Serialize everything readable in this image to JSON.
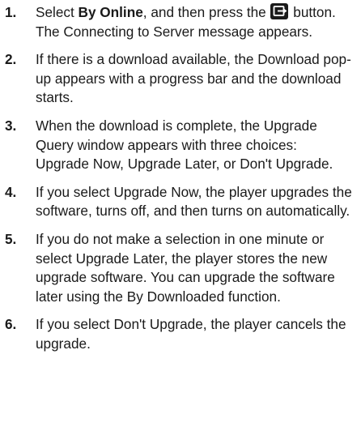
{
  "steps": [
    {
      "number": "1.",
      "pre": "Select ",
      "bold": "By Online",
      "mid": ", and then press the ",
      "icon": "enter-button-icon",
      "post": " button. The Connecting to Server message appears."
    },
    {
      "number": "2.",
      "text": "If there is a download available, the Download pop-up appears with a progress bar and the download starts."
    },
    {
      "number": "3.",
      "text": "When the download is complete, the Upgrade Query window appears with three choices: Upgrade Now, Upgrade Later, or Don't Upgrade."
    },
    {
      "number": "4.",
      "text": "If you select Upgrade Now, the player upgrades the software, turns off, and then turns on automatically."
    },
    {
      "number": "5.",
      "text": "If you do not make a selection in one minute or select Upgrade Later, the player stores the new upgrade software. You can upgrade the software later using the By Downloaded function."
    },
    {
      "number": "6.",
      "text": "If you select Don't Upgrade, the player cancels the upgrade."
    }
  ],
  "colors": {
    "text": "#1a1a1a",
    "background": "#ffffff"
  }
}
